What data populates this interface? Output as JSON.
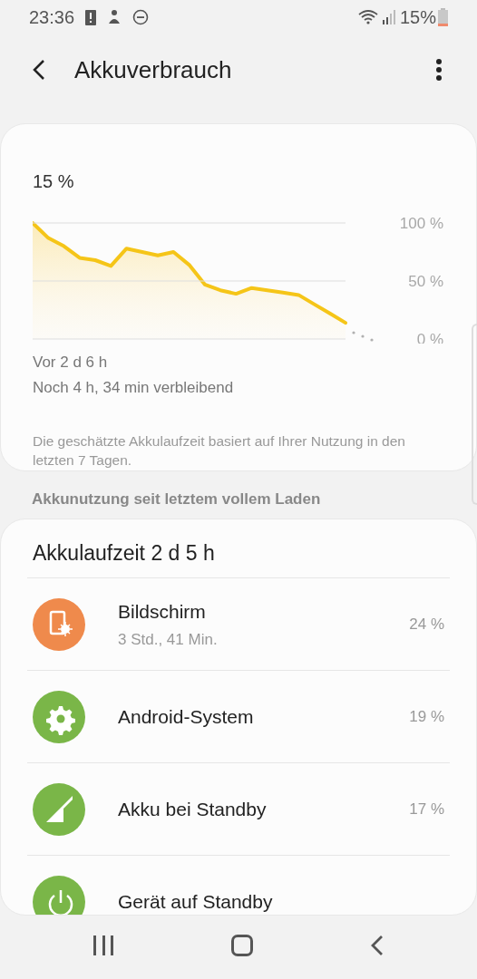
{
  "status_bar": {
    "time": "23:36",
    "battery": "15%"
  },
  "header": {
    "title": "Akkuverbrauch"
  },
  "battery_card": {
    "level_text": "15 %",
    "chart_data": {
      "type": "area",
      "yticks": [
        {
          "value": 100,
          "label": "100 %"
        },
        {
          "value": 50,
          "label": "50 %"
        },
        {
          "value": 0,
          "label": "0 %"
        }
      ],
      "ylim": [
        0,
        100
      ],
      "categories": [
        null,
        null,
        null,
        null,
        null,
        null,
        null,
        null,
        null,
        null,
        null,
        null,
        null,
        null,
        null,
        null,
        null,
        null,
        null,
        null,
        null
      ],
      "series": [
        {
          "color": "#f5c518",
          "values": [
            100,
            87,
            80,
            70,
            68,
            63,
            78,
            75,
            72,
            75,
            64,
            47,
            42,
            39,
            44,
            42,
            40,
            38,
            30,
            22,
            14
          ]
        }
      ]
    },
    "since": "Vor 2 d 6 h",
    "remaining": "Noch 4 h, 34 min verbleibend",
    "note": "Die geschätzte Akkulaufzeit basiert auf Ihrer Nutzung in den letzten 7 Tagen."
  },
  "section_title": "Akkunutzung seit letztem vollem Laden",
  "usage_card": {
    "title": "Akkulaufzeit 2 d 5 h",
    "items": [
      {
        "kind": "screen",
        "color": "#ef8a4c",
        "name": "Bildschirm",
        "detail": "3 Std., 41 Min.",
        "percent": "24 %"
      },
      {
        "kind": "system",
        "color": "#7ab648",
        "name": "Android-System",
        "percent": "19 %"
      },
      {
        "kind": "standby",
        "color": "#7ab648",
        "name": "Akku bei Standby",
        "percent": "17 %"
      },
      {
        "kind": "device",
        "color": "#7ab648",
        "name": "Gerät auf Standby"
      }
    ]
  }
}
